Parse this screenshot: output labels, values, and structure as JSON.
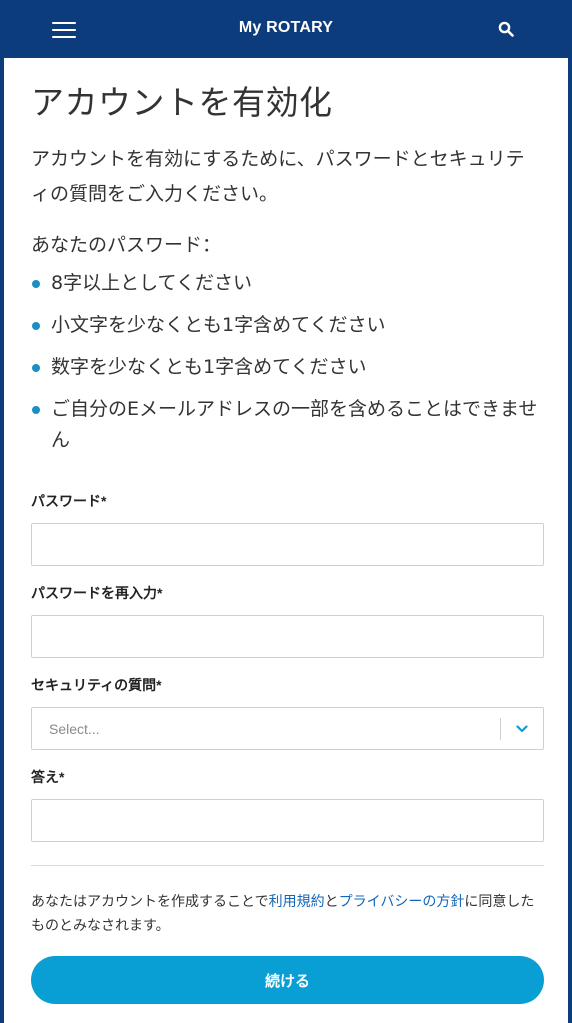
{
  "header": {
    "brand": "My ROTARY",
    "menu_icon": "hamburger-menu-icon",
    "search_icon": "search-icon"
  },
  "page": {
    "title": "アカウントを有効化",
    "intro": "アカウントを有効にするために、パスワードとセキュリティの質問をご入力ください。",
    "password_heading": "あなたのパスワード：",
    "rules": [
      "8字以上としてください",
      "小文字を少なくとも1字含めてください",
      "数字を少なくとも1字含めてください",
      "ご自分のEメールアドレスの一部を含めることはできません"
    ]
  },
  "form": {
    "password_label": "パスワード*",
    "password_value": "",
    "confirm_label": "パスワードを再入力*",
    "confirm_value": "",
    "question_label": "セキュリティの質問*",
    "question_placeholder": "Select...",
    "answer_label": "答え*",
    "answer_value": ""
  },
  "terms": {
    "prefix": "あなたはアカウントを作成することで",
    "terms_link": "利用規約",
    "and": "と",
    "privacy_link": "プライバシーの方針",
    "suffix": "に同意したものとみなされます。"
  },
  "actions": {
    "continue_label": "続ける"
  },
  "colors": {
    "header_bg": "#0c3c7c",
    "accent": "#0a9fd4",
    "bullet": "#1a8fc4",
    "link": "#1466b8"
  }
}
